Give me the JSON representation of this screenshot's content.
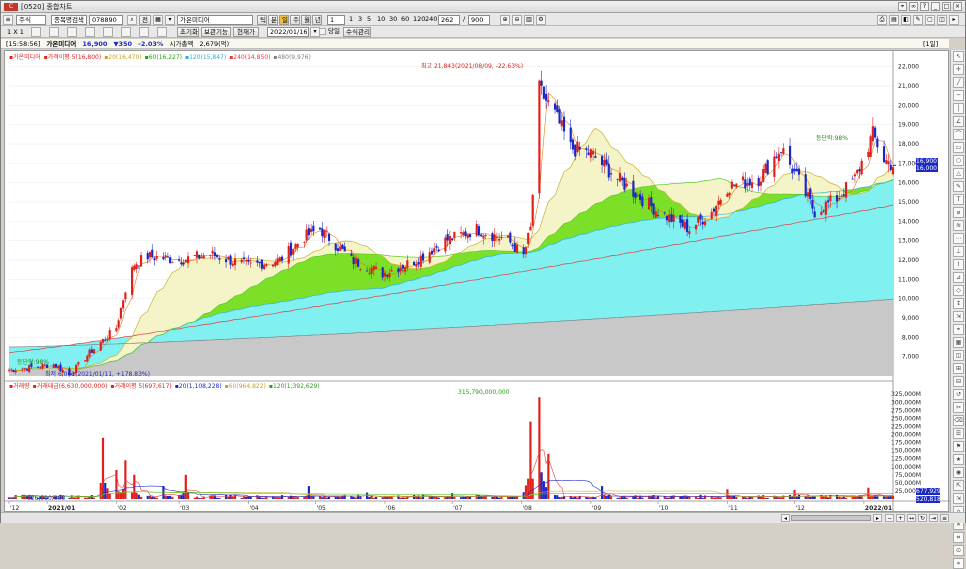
{
  "window": {
    "title": "[0520] 종합차트",
    "logo": "C"
  },
  "toolbar1": {
    "market_select": "주식",
    "search_type": "종목명검색",
    "code": "078890",
    "search_icon": "magnifier-icon",
    "prev_label": "전",
    "stock_name": "가온미디어",
    "period_buttons": [
      "틱",
      "분",
      "일",
      "주",
      "월",
      "년"
    ],
    "active_period": "일",
    "interval_select": "1",
    "interval_buttons": [
      "1",
      "3",
      "5",
      "10",
      "30",
      "60",
      "120",
      "240"
    ],
    "count_value": "262",
    "count_total": "900"
  },
  "toolbar2": {
    "zoom_label": "1 X 1",
    "reset_label": "초기화",
    "save_label": "보관기능",
    "current_label": "현재가",
    "date_value": "2022/01/16",
    "date_check_label": "당일",
    "formula_label": "수식관리"
  },
  "infobar": {
    "time": "[15:58:56]",
    "name": "가온미디어",
    "price": "16,900",
    "change": "▼350",
    "rate": "-2.03%",
    "mcap_label": "시가총액",
    "mcap_value": "2,679(억)",
    "period_tag": "[1일]"
  },
  "colors": {
    "up": "#e0201a",
    "down": "#1a28c8",
    "ma5": "#e08020",
    "ma20": "#c8b430",
    "ma60": "#58c828",
    "ma120": "#30b4e0",
    "ma240": "#e03c3c",
    "ma480": "#808080",
    "fill_20_60": "#f4f4c8",
    "fill_60_120": "#7ce028",
    "fill_120_240": "#80f0f0",
    "fill_240_480": "#c8c8c8"
  },
  "price_legend": [
    {
      "text": "가온미디어",
      "color": "#e0201a"
    },
    {
      "text": "가격이평 5(16,800)",
      "color": "#e0201a"
    },
    {
      "text": "20(16,470)",
      "color": "#c8a020"
    },
    {
      "text": "60(16,227)",
      "color": "#2a9a1a"
    },
    {
      "text": "120(15,847)",
      "color": "#30a8d8"
    },
    {
      "text": "240(14,850)",
      "color": "#e03c3c"
    },
    {
      "text": "480(9,976)",
      "color": "#808080"
    }
  ],
  "volume_legend": [
    {
      "text": "거래량",
      "color": "#e0201a"
    },
    {
      "text": "거래대금(6,630,000,000)",
      "color": "#e0201a"
    },
    {
      "text": "거래이평 5(697,617)",
      "color": "#e0201a"
    },
    {
      "text": "20(1,108,228)",
      "color": "#1a28c8"
    },
    {
      "text": "60(964,822)",
      "color": "#c8a020"
    },
    {
      "text": "120(1,392,629)",
      "color": "#2a9a1a"
    }
  ],
  "annotations": {
    "high": "최고 21,843(2021/08/09, -22.63%)",
    "low": "최저 6,061(2021/01/11, +178.83%)",
    "swing": "등단락:98%",
    "start_marker": "등단락:98%",
    "vol_max": "315,790,000,000",
    "vol_min": "626,000,000",
    "cur_price": "16,900",
    "cur_price2": "16,000",
    "cur_vol": "677,929",
    "cur_vol2": "520,818"
  },
  "price_axis": {
    "min": 6000,
    "max": 22400,
    "ticks": [
      "22,000",
      "21,000",
      "20,000",
      "19,000",
      "18,000",
      "17,000",
      "16,000",
      "15,000",
      "14,000",
      "13,000",
      "12,000",
      "11,000",
      "10,000",
      "9,000",
      "8,000",
      "7,000"
    ],
    "tick_values": [
      22000,
      21000,
      20000,
      19000,
      18000,
      17000,
      16000,
      15000,
      14000,
      13000,
      12000,
      11000,
      10000,
      9000,
      8000,
      7000
    ]
  },
  "volume_axis": {
    "max": 335,
    "unit": "M",
    "ticks": [
      "325,000M",
      "300,000M",
      "275,000M",
      "250,000M",
      "225,000M",
      "200,000M",
      "175,000M",
      "150,000M",
      "125,000M",
      "100,000M",
      "75,000M",
      "50,000M",
      "25,000M"
    ],
    "tick_values": [
      325,
      300,
      275,
      250,
      225,
      200,
      175,
      150,
      125,
      100,
      75,
      50,
      25
    ]
  },
  "time_axis": [
    "'12",
    "2021/01",
    "'02",
    "'03",
    "'04",
    "'05",
    "'06",
    "'07",
    "'08",
    "'09",
    "'10",
    "'11",
    "'12",
    "2022/01"
  ],
  "chart_data": {
    "type": "candlestick",
    "title": "가온미디어",
    "x_range": [
      "2020/12/15",
      "2022/01/14"
    ],
    "y_range": [
      6000,
      22400
    ],
    "price_path": [
      [
        "2020/12/15",
        6300
      ],
      [
        "2021/01/04",
        6600
      ],
      [
        "2021/01/11",
        6061
      ],
      [
        "2021/01/20",
        7200
      ],
      [
        "2021/02/01",
        8500
      ],
      [
        "2021/02/05",
        10500
      ],
      [
        "2021/02/09",
        11800
      ],
      [
        "2021/02/15",
        12200
      ],
      [
        "2021/03/01",
        12000
      ],
      [
        "2021/03/15",
        12300
      ],
      [
        "2021/04/01",
        11700
      ],
      [
        "2021/04/15",
        12000
      ],
      [
        "2021/04/26",
        13200
      ],
      [
        "2021/05/03",
        13600
      ],
      [
        "2021/05/17",
        12000
      ],
      [
        "2021/05/31",
        11300
      ],
      [
        "2021/06/15",
        12000
      ],
      [
        "2021/06/28",
        13000
      ],
      [
        "2021/07/12",
        13600
      ],
      [
        "2021/07/26",
        13000
      ],
      [
        "2021/08/02",
        12200
      ],
      [
        "2021/08/05",
        13600
      ],
      [
        "2021/08/09",
        20800
      ],
      [
        "2021/08/16",
        19500
      ],
      [
        "2021/08/23",
        17800
      ],
      [
        "2021/09/01",
        17500
      ],
      [
        "2021/09/15",
        16000
      ],
      [
        "2021/10/01",
        14500
      ],
      [
        "2021/10/15",
        13600
      ],
      [
        "2021/10/25",
        14500
      ],
      [
        "2021/11/01",
        15800
      ],
      [
        "2021/11/15",
        16200
      ],
      [
        "2021/11/25",
        17800
      ],
      [
        "2021/12/01",
        16500
      ],
      [
        "2021/12/10",
        14500
      ],
      [
        "2021/12/20",
        15200
      ],
      [
        "2021/12/28",
        16200
      ],
      [
        "2022/01/05",
        18500
      ],
      [
        "2022/01/10",
        17200
      ],
      [
        "2022/01/14",
        16900
      ]
    ],
    "ma_series": [
      {
        "name": "가격이평 5",
        "last": 16800
      },
      {
        "name": "20",
        "last": 16470
      },
      {
        "name": "60",
        "last": 16227
      },
      {
        "name": "120",
        "last": 15847
      },
      {
        "name": "240",
        "last": 14850
      },
      {
        "name": "480",
        "last": 9976
      }
    ],
    "volume_peaks": [
      [
        "2021/01/26",
        190
      ],
      [
        "2021/02/01",
        90
      ],
      [
        "2021/02/05",
        120
      ],
      [
        "2021/02/09",
        75
      ],
      [
        "2021/02/22",
        40
      ],
      [
        "2021/03/04",
        75
      ],
      [
        "2021/04/28",
        40
      ],
      [
        "2021/05/24",
        20
      ],
      [
        "2021/07/01",
        18
      ],
      [
        "2021/08/05",
        240
      ],
      [
        "2021/08/09",
        315.79
      ],
      [
        "2021/08/13",
        140
      ],
      [
        "2021/09/06",
        40
      ],
      [
        "2021/11/01",
        30
      ],
      [
        "2021/12/01",
        28
      ],
      [
        "2022/01/03",
        35
      ]
    ]
  }
}
